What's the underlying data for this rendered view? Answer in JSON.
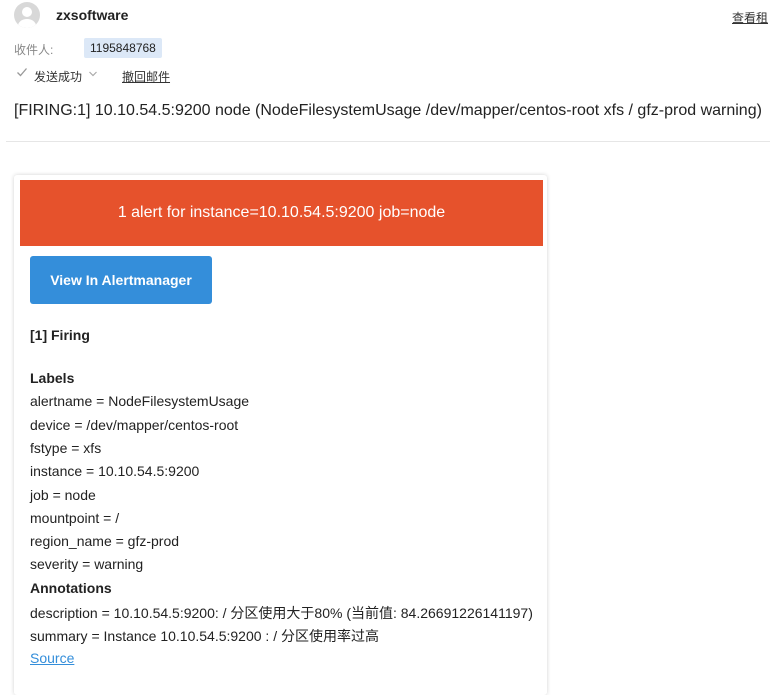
{
  "header": {
    "sender_name": "zxsoftware",
    "view_link": "查看租",
    "recipient_label": "收件人:",
    "recipient": "1195848768",
    "status": "发送成功",
    "recall": "撤回邮件",
    "subject": "[FIRING:1] 10.10.54.5:9200 node (NodeFilesystemUsage /dev/mapper/centos-root xfs / gfz-prod warning)"
  },
  "email": {
    "banner": "1 alert for instance=10.10.54.5:9200 job=node",
    "button_label": "View In Alertmanager",
    "firing_title": "[1] Firing",
    "labels_title": "Labels",
    "labels": [
      "alertname = NodeFilesystemUsage",
      "device = /dev/mapper/centos-root",
      "fstype = xfs",
      "instance = 10.10.54.5:9200",
      "job = node",
      "mountpoint = /",
      "region_name = gfz-prod",
      "severity = warning"
    ],
    "annotations_title": "Annotations",
    "annotations": [
      "description = 10.10.54.5:9200: / 分区使用大于80% (当前值: 84.26691226141197)",
      "summary = Instance 10.10.54.5:9200 : / 分区使用率过高"
    ],
    "source_link": "Source"
  },
  "colors": {
    "banner": "#e6522c",
    "button": "#348eda",
    "chip": "#dce8f7"
  }
}
